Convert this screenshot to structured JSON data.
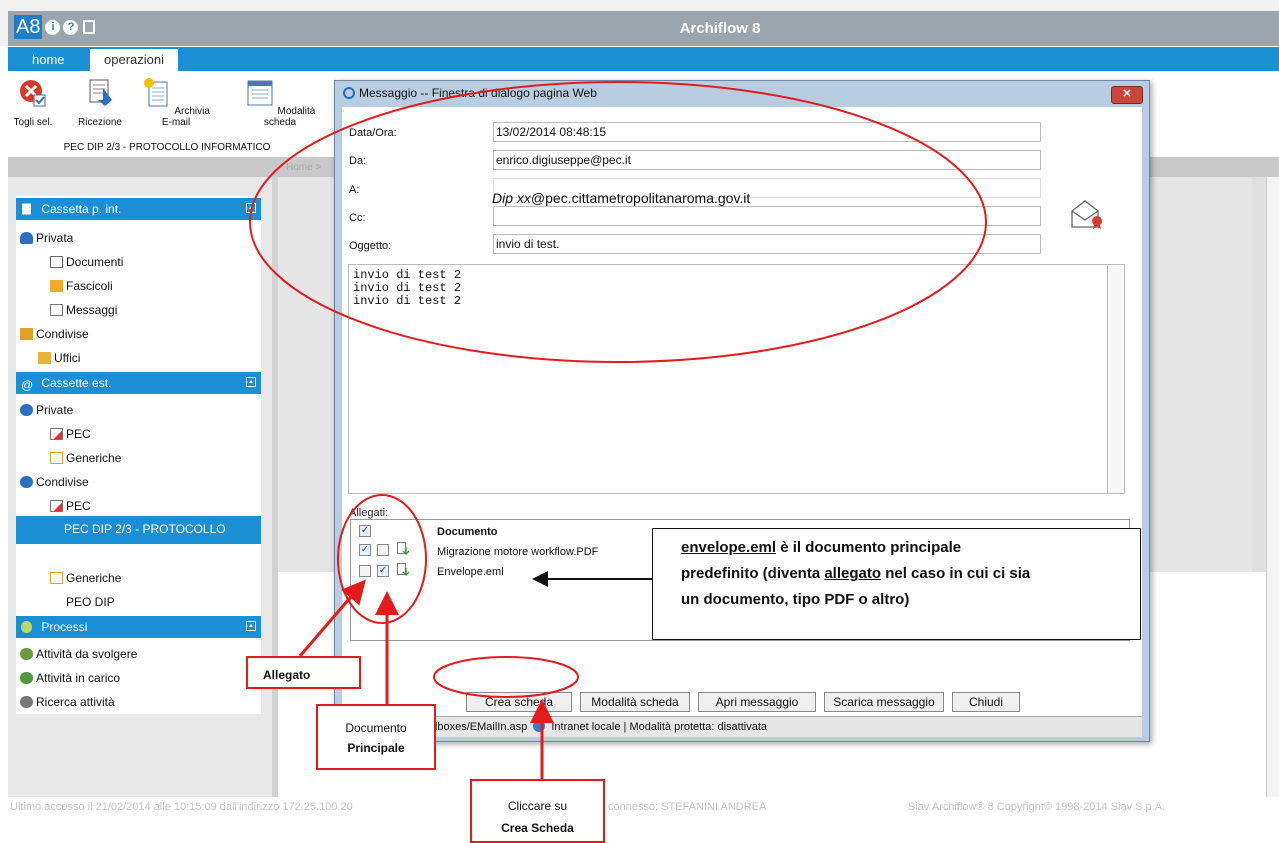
{
  "app": {
    "logo": "A8",
    "title": "Archiflow 8",
    "tabs": [
      "home",
      "operazioni"
    ]
  },
  "ribbon": {
    "buttons": [
      "Togli sel.",
      "Ricezione",
      "Archivia E-mail",
      "Modalità scheda"
    ],
    "group_label": "PEC DIP 2/3 - PROTOCOLLO INFORMATICO"
  },
  "breadcrumb": "Home >",
  "sidebar": {
    "sections": [
      {
        "label": "Cassetta p. int."
      },
      {
        "label": "Cassette est."
      },
      {
        "label": "Processi"
      }
    ],
    "items": [
      "Privata",
      "Documenti",
      "Fascicoli",
      "Messaggi",
      "Condivise",
      "Uffici",
      "Private",
      "PEC",
      "Generiche",
      "Condivise",
      "PEC",
      "PEC DIP 2/3 - PROTOCOLLO",
      "Generiche",
      "PEO DIP",
      "Attività da svolgere",
      "Attività in carico",
      "Ricerca attività"
    ]
  },
  "dialog": {
    "title": "Messaggio -- Finestra di dialogo pagina Web",
    "close": "✕",
    "fields": {
      "date_label": "Data/Ora:",
      "date_value": "13/02/2014 08:48:15",
      "from_label": "Da:",
      "from_value": "enrico.digiuseppe@pec.it",
      "to_label": "A:",
      "to_value_italic": "Dip xx",
      "to_value_rest": "@pec.cittametropolitanaroma.gov.it",
      "cc_label": "Cc:",
      "cc_value": "",
      "subject_label": "Oggetto:",
      "subject_value": "invio di test."
    },
    "body": "invio di test 2\ninvio di test 2\ninvio di test 2",
    "attachments_label": "Allegati:",
    "attachments_header": "Documento",
    "attachments": [
      {
        "name": "Migrazione motore workflow.PDF",
        "allegato": true,
        "principale": false
      },
      {
        "name": "Envelope.eml",
        "allegato": false,
        "principale": true
      }
    ],
    "buttons": [
      "Crea scheda",
      "Modalità scheda",
      "Apri messaggio",
      "Scarica messaggio",
      "Chiudi"
    ],
    "status": "/archiflowweb/sMailboxes/EMailIn.asp",
    "status_zone": "Intranet locale | Modalità protetta: disattivata"
  },
  "callouts": {
    "note_line1_u": "envelope.eml",
    "note_line1_rest": " è il documento principale",
    "note_line2_a": "predefinito (diventa ",
    "note_line2_u": "allegato",
    "note_line2_b": " nel caso in cui ci sia",
    "note_line3": "un documento, tipo PDF o altro)",
    "allegato": "Allegato",
    "doc_principale_1": "Documento",
    "doc_principale_2": "Principale",
    "crea_1": "Cliccare su",
    "crea_2": "Crea Scheda"
  },
  "footer": {
    "left": "Ultimo accesso il 21/02/2014 alle 10:15:09 dall'indirizzo 172.25.100.20",
    "mid": "connesso: STEFANINI ANDREA",
    "right": "Siav Archiflow® 8 Copyright© 1998-2014 Siav S.p.A."
  },
  "colors": {
    "accent": "#1b8fd6",
    "annotation": "#e31b1b",
    "dialog_frame": "#b8cde0"
  }
}
